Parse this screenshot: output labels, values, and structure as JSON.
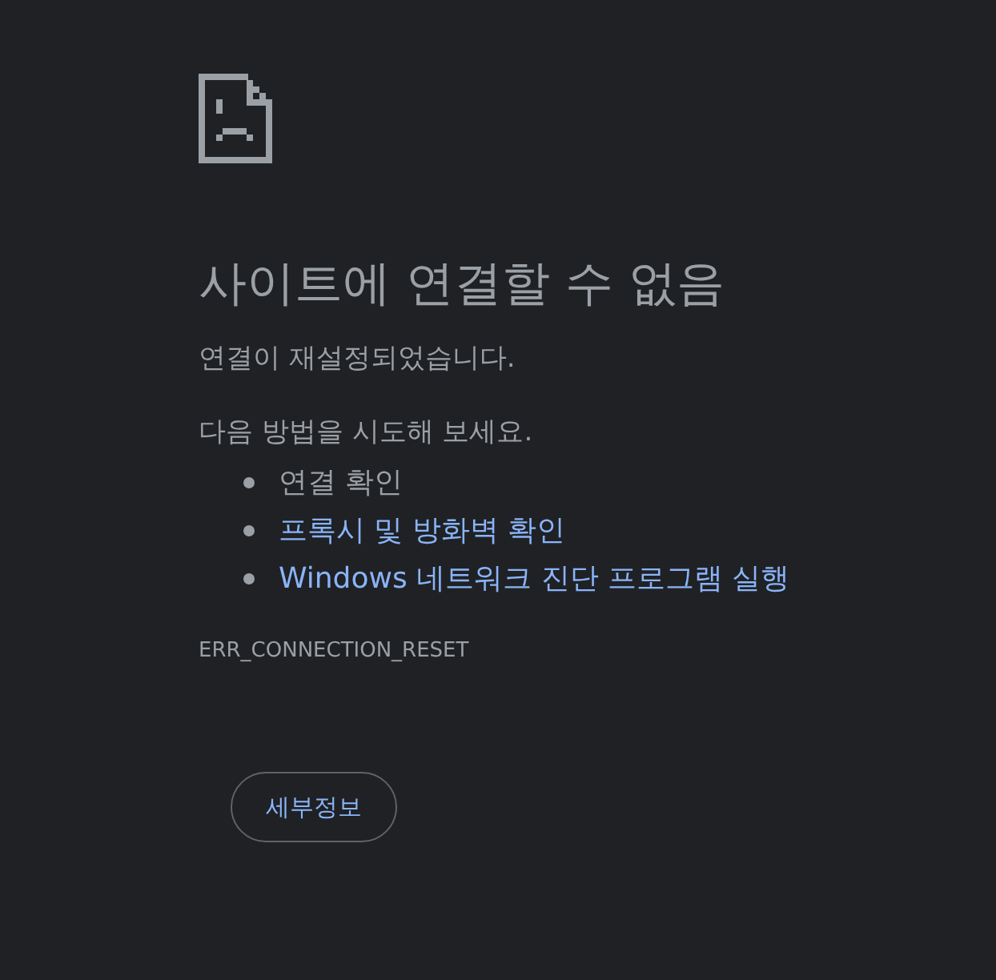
{
  "heading": "사이트에 연결할 수 없음",
  "message": "연결이 재설정되었습니다.",
  "suggestions_intro": "다음 방법을 시도해 보세요.",
  "suggestions": [
    {
      "kind": "text",
      "label": "연결 확인"
    },
    {
      "kind": "link",
      "label": "프록시 및 방화벽 확인"
    },
    {
      "kind": "link",
      "label": "Windows 네트워크 진단 프로그램 실행"
    }
  ],
  "error_code": "ERR_CONNECTION_RESET",
  "details_button": "세부정보"
}
